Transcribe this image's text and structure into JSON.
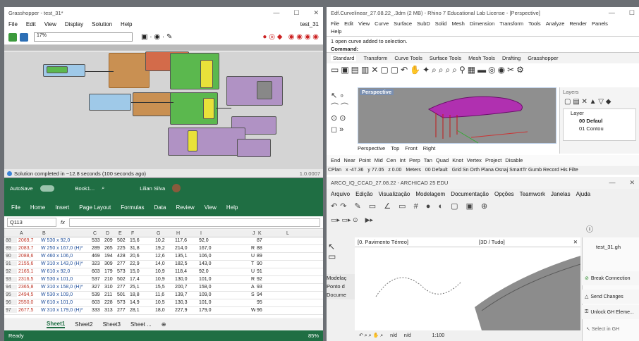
{
  "gh": {
    "title": "Grasshopper - test_31*",
    "menu": [
      "File",
      "Edit",
      "View",
      "Display",
      "Solution",
      "Help"
    ],
    "doc": "test_31",
    "zoom": "17%",
    "status": "Solution completed in ~12.8 seconds (100 seconds ago)",
    "version": "1.0.0007"
  },
  "rhino": {
    "title": "Edf.Curvelinear_27.08.22_.3dm (2 MB) - Rhino 7 Educational Lab License - [Perspective]",
    "menu": [
      "File",
      "Edit",
      "View",
      "Curve",
      "Surface",
      "SubD",
      "Solid",
      "Mesh",
      "Dimension",
      "Transform",
      "Tools",
      "Analyze",
      "Render",
      "Panels"
    ],
    "menu_help": "Help",
    "cmd_history": "1 open curve added to selection.",
    "cmd_prompt": "Command:",
    "tabs": [
      "Standard",
      "Transform",
      "Curve Tools",
      "Surface Tools",
      "Mesh Tools",
      "Drafting",
      "Grasshopper"
    ],
    "viewport": "Perspective",
    "view_tabs": [
      "Perspective",
      "Top",
      "Front",
      "Right"
    ],
    "layers_title": "Layers",
    "layer_col": "Layer",
    "layer1": "00 Defaul",
    "layer2": "01 Contou",
    "osnaps": [
      "End",
      "Near",
      "Point",
      "Mid",
      "Cen",
      "Int",
      "Perp",
      "Tan",
      "Quad",
      "Knot",
      "Vertex",
      "Project",
      "Disable"
    ],
    "status": {
      "cplane": "CPlan",
      "x": "x -47.36",
      "y": "y 77.05",
      "z": "z 0.00",
      "units": "Meters",
      "layer": "00 Default",
      "toggles": "Grid Sn Orth Plana Osnaj SmartTr Gumb Record His Filte"
    }
  },
  "excel": {
    "autosave": "AutoSave",
    "book": "Book1...",
    "user": "Lilian Silva",
    "menu": [
      "File",
      "Home",
      "Insert",
      "Page Layout",
      "Formulas",
      "Data",
      "Review",
      "View",
      "Help"
    ],
    "namebox": "Q113",
    "fx": "fx",
    "cols": [
      "A",
      "B",
      "C",
      "D",
      "E",
      "F",
      "G",
      "H",
      "I",
      "J",
      "K",
      "L"
    ],
    "rows": [
      [
        "88",
        "2069,7",
        "W 530 x 92,0",
        "533",
        "209",
        "502",
        "15,6",
        "10,2",
        "117,6",
        "92,0",
        "",
        "87"
      ],
      [
        "89",
        "2083,7",
        "W 250 x 167,0 (H)*",
        "289",
        "265",
        "225",
        "31,8",
        "19,2",
        "214,0",
        "167,0",
        "R",
        "88"
      ],
      [
        "90",
        "2088,6",
        "W 460 x 106,0",
        "469",
        "194",
        "428",
        "20,6",
        "12,6",
        "135,1",
        "106,0",
        "U",
        "89"
      ],
      [
        "91",
        "2155,6",
        "W 310 x 143,0 (H)*",
        "323",
        "309",
        "277",
        "22,9",
        "14,0",
        "182,5",
        "143,0",
        "T",
        "90"
      ],
      [
        "92",
        "2165,1",
        "W 610 x 92,0",
        "603",
        "179",
        "573",
        "15,0",
        "10,9",
        "118,4",
        "92,0",
        "U",
        "91"
      ],
      [
        "93",
        "2316,5",
        "W 530 x 101,0",
        "537",
        "210",
        "502",
        "17,4",
        "10,9",
        "130,0",
        "101,0",
        "R",
        "92"
      ],
      [
        "94",
        "2365,8",
        "W 310 x 158,0 (H)*",
        "327",
        "310",
        "277",
        "25,1",
        "15,5",
        "200,7",
        "158,0",
        "A",
        "93"
      ],
      [
        "95",
        "2494,5",
        "W 530 x 109,0",
        "539",
        "211",
        "501",
        "18,8",
        "11,6",
        "139,7",
        "109,0",
        "S",
        "94"
      ],
      [
        "96",
        "2550,0",
        "W 610 x 101,0",
        "603",
        "228",
        "573",
        "14,9",
        "10,5",
        "130,3",
        "101,0",
        "",
        "95"
      ],
      [
        "97",
        "2677,5",
        "W 310 x 179,0 (H)*",
        "333",
        "313",
        "277",
        "28,1",
        "18,0",
        "227,9",
        "179,0",
        "W",
        "96"
      ]
    ],
    "sheets": [
      "Sheet1",
      "Sheet2",
      "Sheet3",
      "Sheet ..."
    ],
    "status": "Ready",
    "zoom": "85%"
  },
  "archicad": {
    "title": "ARCO_IQ_CCAD_27.08.22 - ARCHICAD 25 EDU",
    "menu": [
      "Arquivo",
      "Edição",
      "Visualização",
      "Modelagem",
      "Documentação",
      "Opções",
      "Teamwork",
      "Janelas",
      "Ajuda"
    ],
    "tab1": "[0. Pavimento Térreo]",
    "tab2": "[3D / Tudo]",
    "side_labels": [
      "Modelaç",
      "Ponto d",
      "Docume"
    ],
    "gh_file": "test_31.gh",
    "buttons": [
      "Break Connection",
      "Send Changes",
      "Unlock GH Eleme..."
    ],
    "select": "Select in GH",
    "zoom": "1:100",
    "na1": "n/d",
    "na2": "n/d"
  },
  "colors": {
    "excel_green": "#1f6e43",
    "gh_green": "#5bb84e",
    "gh_orange": "#c99052",
    "gh_yellow": "#e9e13a",
    "gh_purple": "#b092c4",
    "rhino_mesh": "#a020a0"
  }
}
